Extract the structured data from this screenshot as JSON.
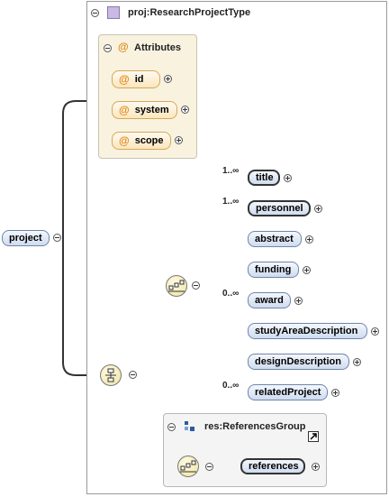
{
  "type_panel": {
    "title": "proj:ResearchProjectType",
    "icon": "complex-type-icon"
  },
  "attributes_group": {
    "title": "Attributes",
    "icon": "attribute-at-icon",
    "items": [
      {
        "symbol": "@",
        "label": "id"
      },
      {
        "symbol": "@",
        "label": "system"
      },
      {
        "symbol": "@",
        "label": "scope"
      }
    ]
  },
  "root_element": {
    "label": "project"
  },
  "sequence": {
    "icon": "sequence-compositor-icon",
    "elements": [
      {
        "label": "title",
        "cardinality": "1..∞",
        "required": true
      },
      {
        "label": "personnel",
        "cardinality": "1..∞",
        "required": true
      },
      {
        "label": "abstract",
        "cardinality": "",
        "required": false
      },
      {
        "label": "funding",
        "cardinality": "",
        "required": false
      },
      {
        "label": "award",
        "cardinality": "0..∞",
        "required": false
      },
      {
        "label": "studyAreaDescription",
        "cardinality": "",
        "required": false
      },
      {
        "label": "designDescription",
        "cardinality": "",
        "required": false
      },
      {
        "label": "relatedProject",
        "cardinality": "0..∞",
        "required": false
      }
    ]
  },
  "outer_compositor": {
    "icon": "choice-compositor-icon"
  },
  "reference_group": {
    "title": "res:ReferencesGroup",
    "icon": "group-icon",
    "link_icon": "external-link-icon",
    "element": {
      "label": "references",
      "required": true
    }
  },
  "colors": {
    "element_fill": "#cfdcef",
    "element_border": "#6f86a8",
    "attribute_fill": "#fbe6bd",
    "attribute_panel": "#f8f2df",
    "compositor_fill": "#efe2a0",
    "connector": "#333333",
    "faint_connector": "#bdbdbd"
  }
}
